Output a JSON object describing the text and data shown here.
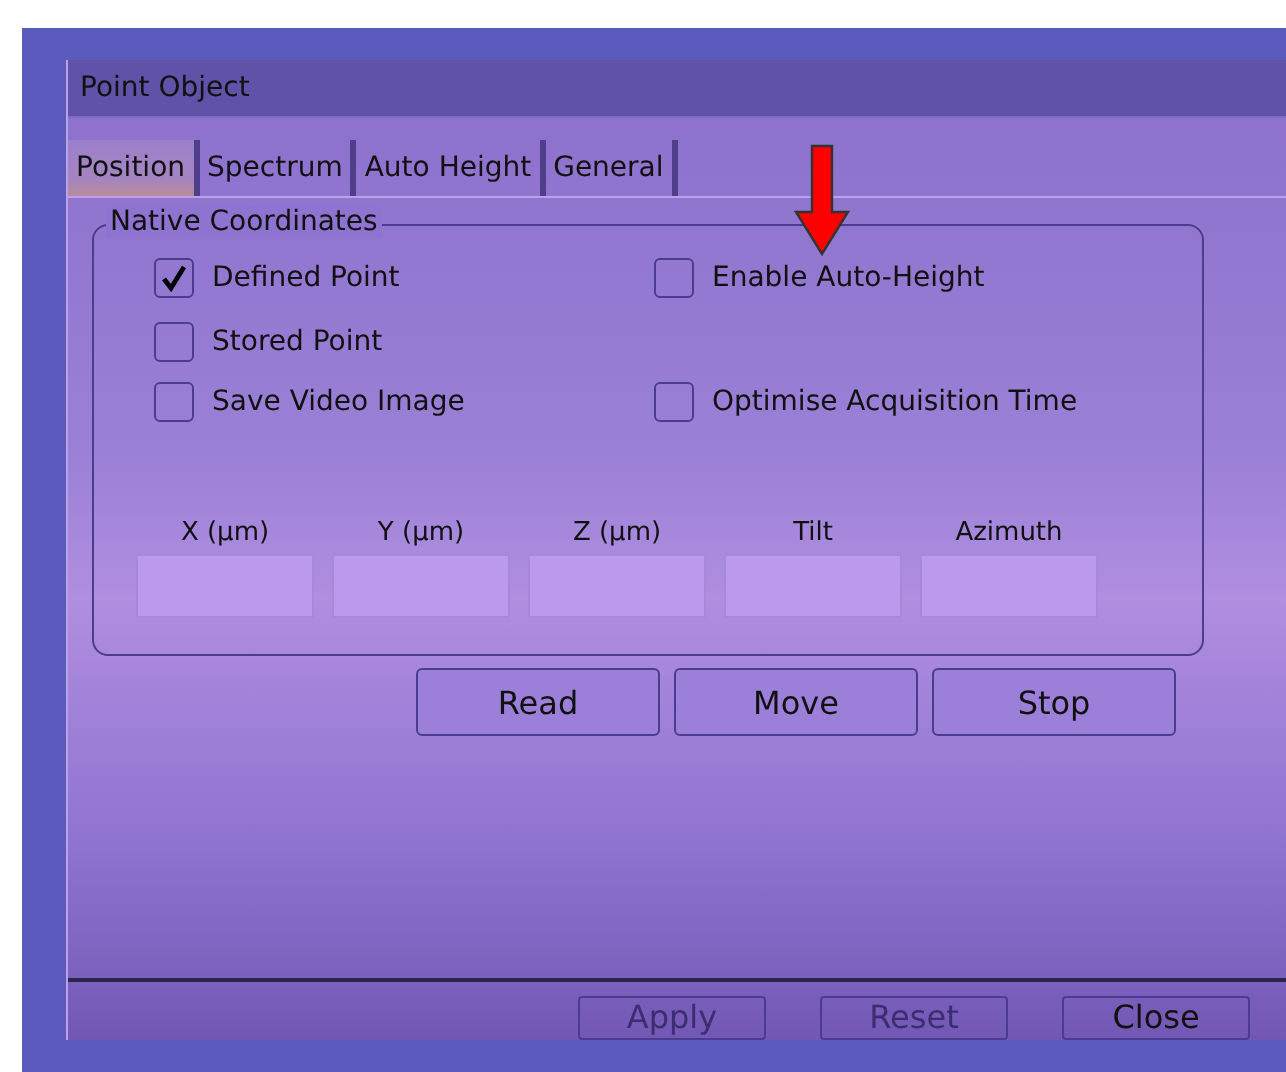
{
  "window": {
    "title": "Point Object"
  },
  "tabs": [
    {
      "label": "Position",
      "selected": true
    },
    {
      "label": "Spectrum",
      "selected": false
    },
    {
      "label": "Auto Height",
      "selected": false
    },
    {
      "label": "General",
      "selected": false
    }
  ],
  "group": {
    "title": "Native Coordinates",
    "left_options": [
      {
        "label": "Defined Point",
        "checked": true
      },
      {
        "label": "Stored Point",
        "checked": false
      },
      {
        "label": "Save Video Image",
        "checked": false
      }
    ],
    "right_options": [
      {
        "label": "Enable Auto-Height",
        "checked": false
      },
      {
        "label": "Optimise Acquisition Time",
        "checked": false
      }
    ],
    "fields": [
      {
        "label": "X (µm)"
      },
      {
        "label": "Y (µm)"
      },
      {
        "label": "Z (µm)"
      },
      {
        "label": "Tilt"
      },
      {
        "label": "Azimuth"
      }
    ]
  },
  "actions": [
    "Read",
    "Move",
    "Stop"
  ],
  "footer_buttons": [
    {
      "label": "Apply",
      "disabled": true
    },
    {
      "label": "Reset",
      "disabled": true
    },
    {
      "label": "Close",
      "disabled": false
    }
  ]
}
